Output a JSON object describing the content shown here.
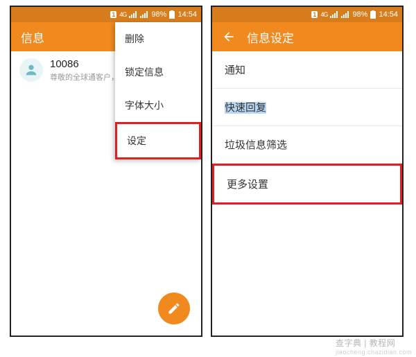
{
  "status": {
    "sim": "1",
    "net": "4G",
    "battery": "98%",
    "time": "14:54"
  },
  "left": {
    "title": "信息",
    "conversation": {
      "name": "10086",
      "preview": "尊敬的全球通客户，1…"
    },
    "menu": {
      "items": [
        {
          "label": "删除"
        },
        {
          "label": "锁定信息"
        },
        {
          "label": "字体大小"
        },
        {
          "label": "设定"
        }
      ]
    }
  },
  "right": {
    "title": "信息设定",
    "settings": [
      {
        "label": "通知"
      },
      {
        "label": "快速回复"
      },
      {
        "label": "垃圾信息筛选"
      },
      {
        "label": "更多设置"
      }
    ]
  },
  "watermark": {
    "main": "查字典 | 教程网",
    "sub": "jiaocheng.chazidian.com"
  }
}
